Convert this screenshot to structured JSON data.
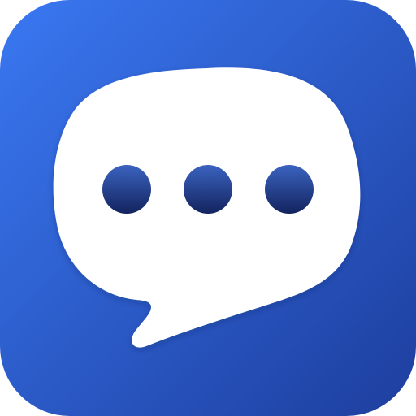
{
  "app_icon": {
    "icon_name": "chat-bubble-icon",
    "dot_icon_name": "typing-dot-icon",
    "dot_count": 3,
    "colors": {
      "background_top_left": "#3A78F2",
      "background_bottom_right": "#1D3E9E",
      "bubble": "#FFFFFF",
      "dot_top": "#3B63C0",
      "dot_bottom": "#13235E"
    }
  }
}
